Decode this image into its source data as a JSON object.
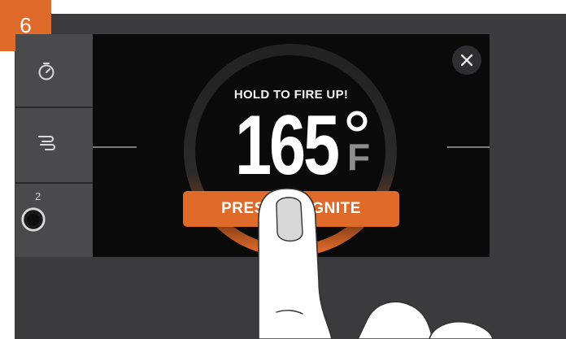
{
  "step": {
    "number": "6"
  },
  "sidebar": {
    "items": [
      {
        "icon": "timer-icon"
      },
      {
        "icon": "smoke-icon"
      },
      {
        "icon": "probe-port-icon",
        "label": "2"
      }
    ]
  },
  "screen": {
    "hold_label": "HOLD TO FIRE UP!",
    "temperature": "165",
    "degree_icon": "degree-icon",
    "unit": "F",
    "ignite_label": "PRESS TO IGNITE",
    "close_icon": "close-icon"
  },
  "colors": {
    "accent": "#e06a2a",
    "screen_bg": "#0a0a0a",
    "device_bg": "#3b3b3d",
    "sidebar_bg": "#4a4a4d"
  }
}
